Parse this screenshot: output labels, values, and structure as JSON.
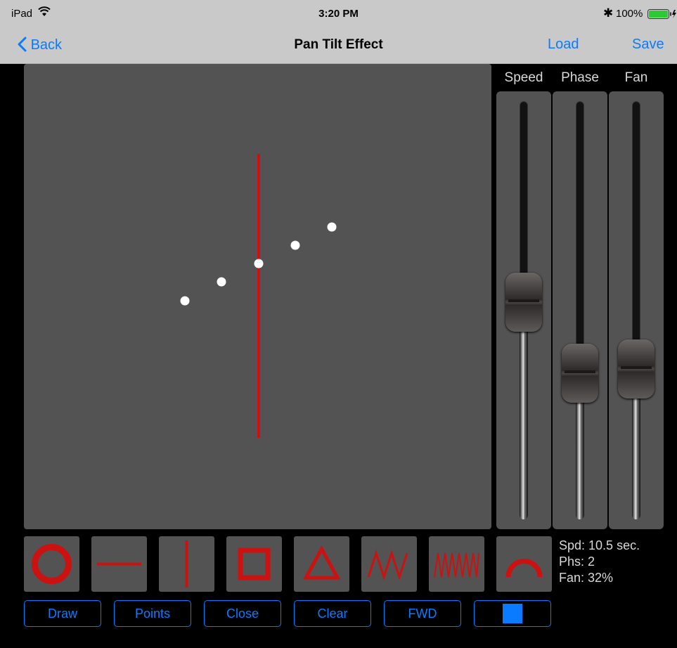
{
  "status_bar": {
    "device": "iPad",
    "time": "3:20 PM",
    "battery": "100%"
  },
  "nav": {
    "back_label": "Back",
    "title": "Pan Tilt Effect",
    "load_label": "Load",
    "save_label": "Save"
  },
  "sliders": [
    {
      "label": "Speed",
      "value": 0.52
    },
    {
      "label": "Phase",
      "value": 0.35
    },
    {
      "label": "Fan",
      "value": 0.36
    }
  ],
  "shapes": [
    "circle-shape",
    "horizontal-line-shape",
    "vertical-line-shape",
    "square-shape",
    "triangle-shape",
    "zigzag-shape",
    "dense-zigzag-shape",
    "arc-shape"
  ],
  "info": {
    "speed": "Spd: 10.5 sec.",
    "phase": "Phs: 2",
    "fan": "Fan: 32%"
  },
  "buttons": {
    "draw": "Draw",
    "points": "Points",
    "close": "Close",
    "clear": "Clear",
    "fwd": "FWD"
  },
  "colors": {
    "accent": "#0a7aff",
    "path": "#cc1111",
    "panel": "#535353"
  }
}
